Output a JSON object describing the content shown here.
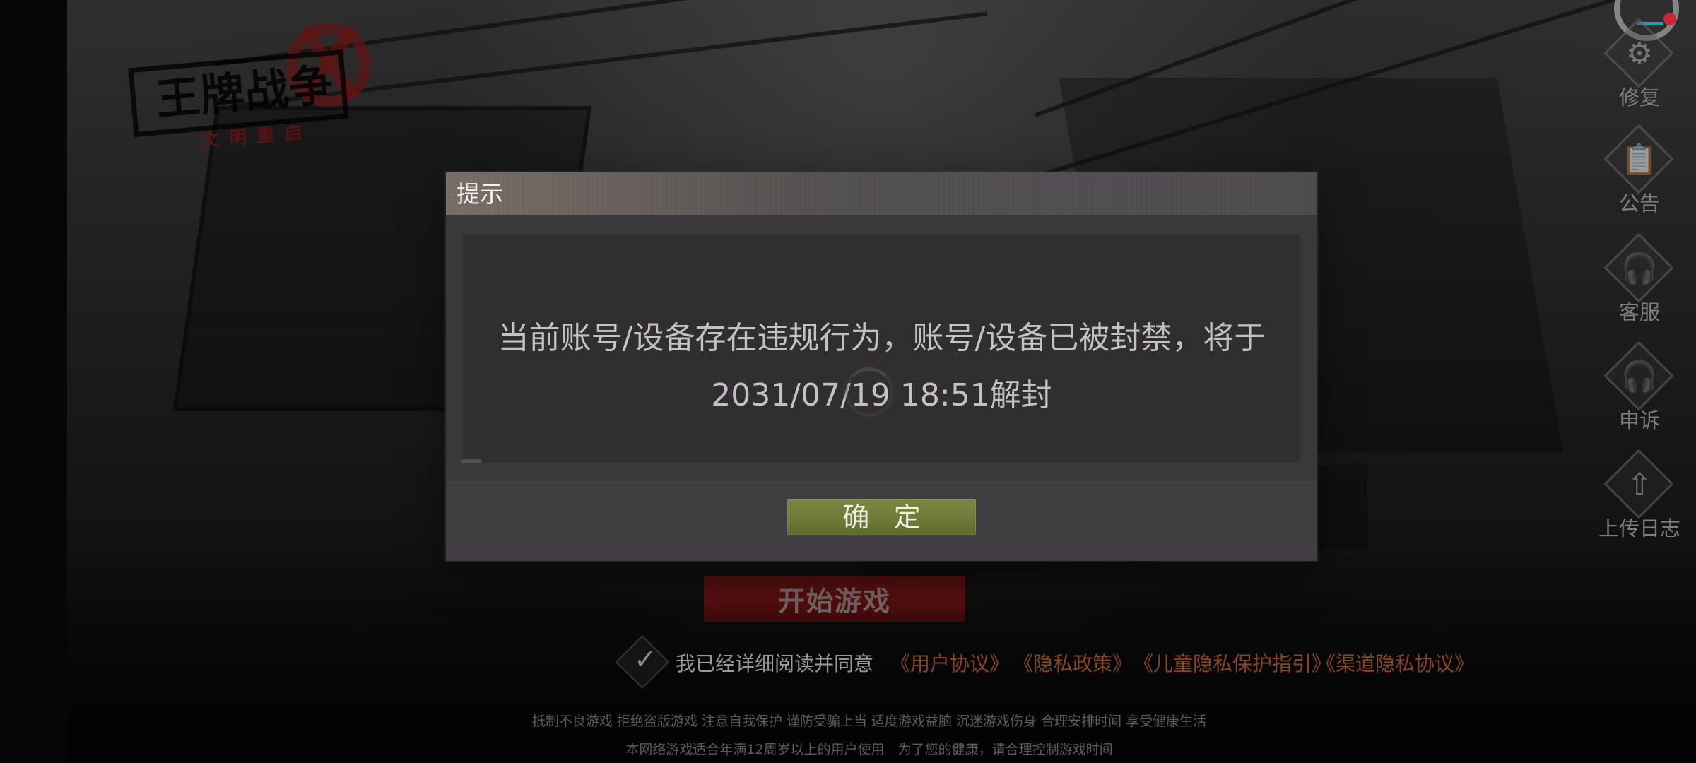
{
  "app": {
    "logo_title": "王牌战争",
    "logo_subtitle": "文明重启"
  },
  "right_rail": {
    "items": [
      {
        "label": "修复",
        "icon": "gear-icon"
      },
      {
        "label": "公告",
        "icon": "clipboard-notice-icon"
      },
      {
        "label": "客服",
        "icon": "headset-icon"
      },
      {
        "label": "申诉",
        "icon": "appeal-headset-icon"
      },
      {
        "label": "上传日志",
        "icon": "upload-icon"
      }
    ]
  },
  "dialog": {
    "title": "提示",
    "message": "当前账号/设备存在违规行为，账号/设备已被封禁，将于2031/07/19 18:51解封",
    "confirm_label": "确 定"
  },
  "main": {
    "start_label": "开始游戏",
    "agreement_text": "我已经详细阅读并同意",
    "policy_links": [
      "《用户协议》",
      "《隐私政策》",
      "《儿童隐私保护指引》",
      "《渠道隐私协议》"
    ],
    "health_notice_1": "抵制不良游戏 拒绝盗版游戏 注意自我保护 谨防受骗上当 适度游戏益脑 沉迷游戏伤身 合理安排时间 享受健康生活",
    "health_notice_2": "本网络游戏适合年满12周岁以上的用户使用　为了您的健康，请合理控制游戏时间"
  },
  "colors": {
    "dialog_bg": "#3a383b",
    "message_panel": "#302e31",
    "confirm_button": "#6f7c39",
    "start_button": "#7a1515",
    "policy_link": "#b05a2f",
    "status_dot": "#ff3348",
    "status_accent": "#2bd2d8"
  }
}
